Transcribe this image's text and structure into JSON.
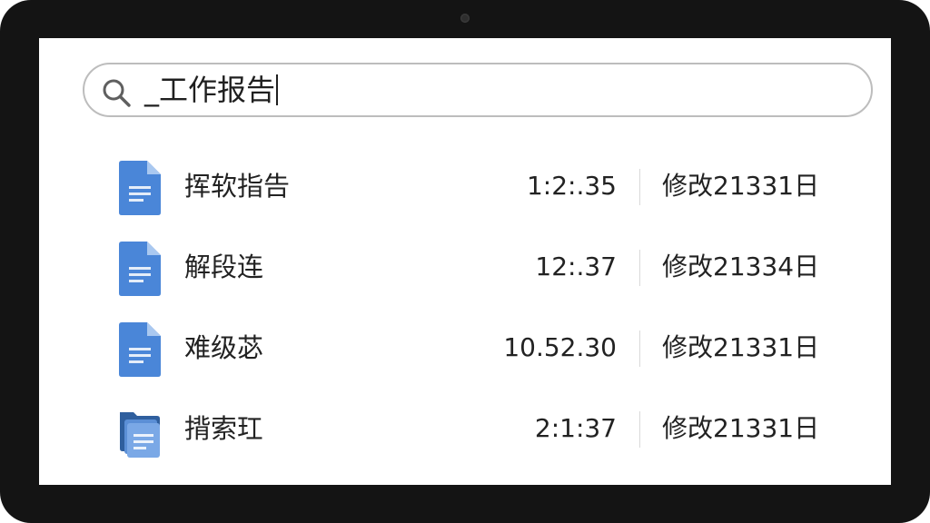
{
  "search": {
    "query": "_工作报告"
  },
  "results": [
    {
      "icon": "document-icon",
      "name": "挥软指告",
      "time": "1:2:.35",
      "modified": "修改21331日"
    },
    {
      "icon": "document-icon",
      "name": "解段连",
      "time": "12:.37",
      "modified": "修改21334日"
    },
    {
      "icon": "document-icon",
      "name": "难级苾",
      "time": "10.52.30",
      "modified": "修改21331日"
    },
    {
      "icon": "folder-documents-icon",
      "name": "揹索玒",
      "time": "2:1:37",
      "modified": "修改21331日"
    }
  ],
  "colors": {
    "doc_blue": "#4a86d8",
    "doc_fold": "#a9c8f0",
    "frame": "#141414"
  }
}
